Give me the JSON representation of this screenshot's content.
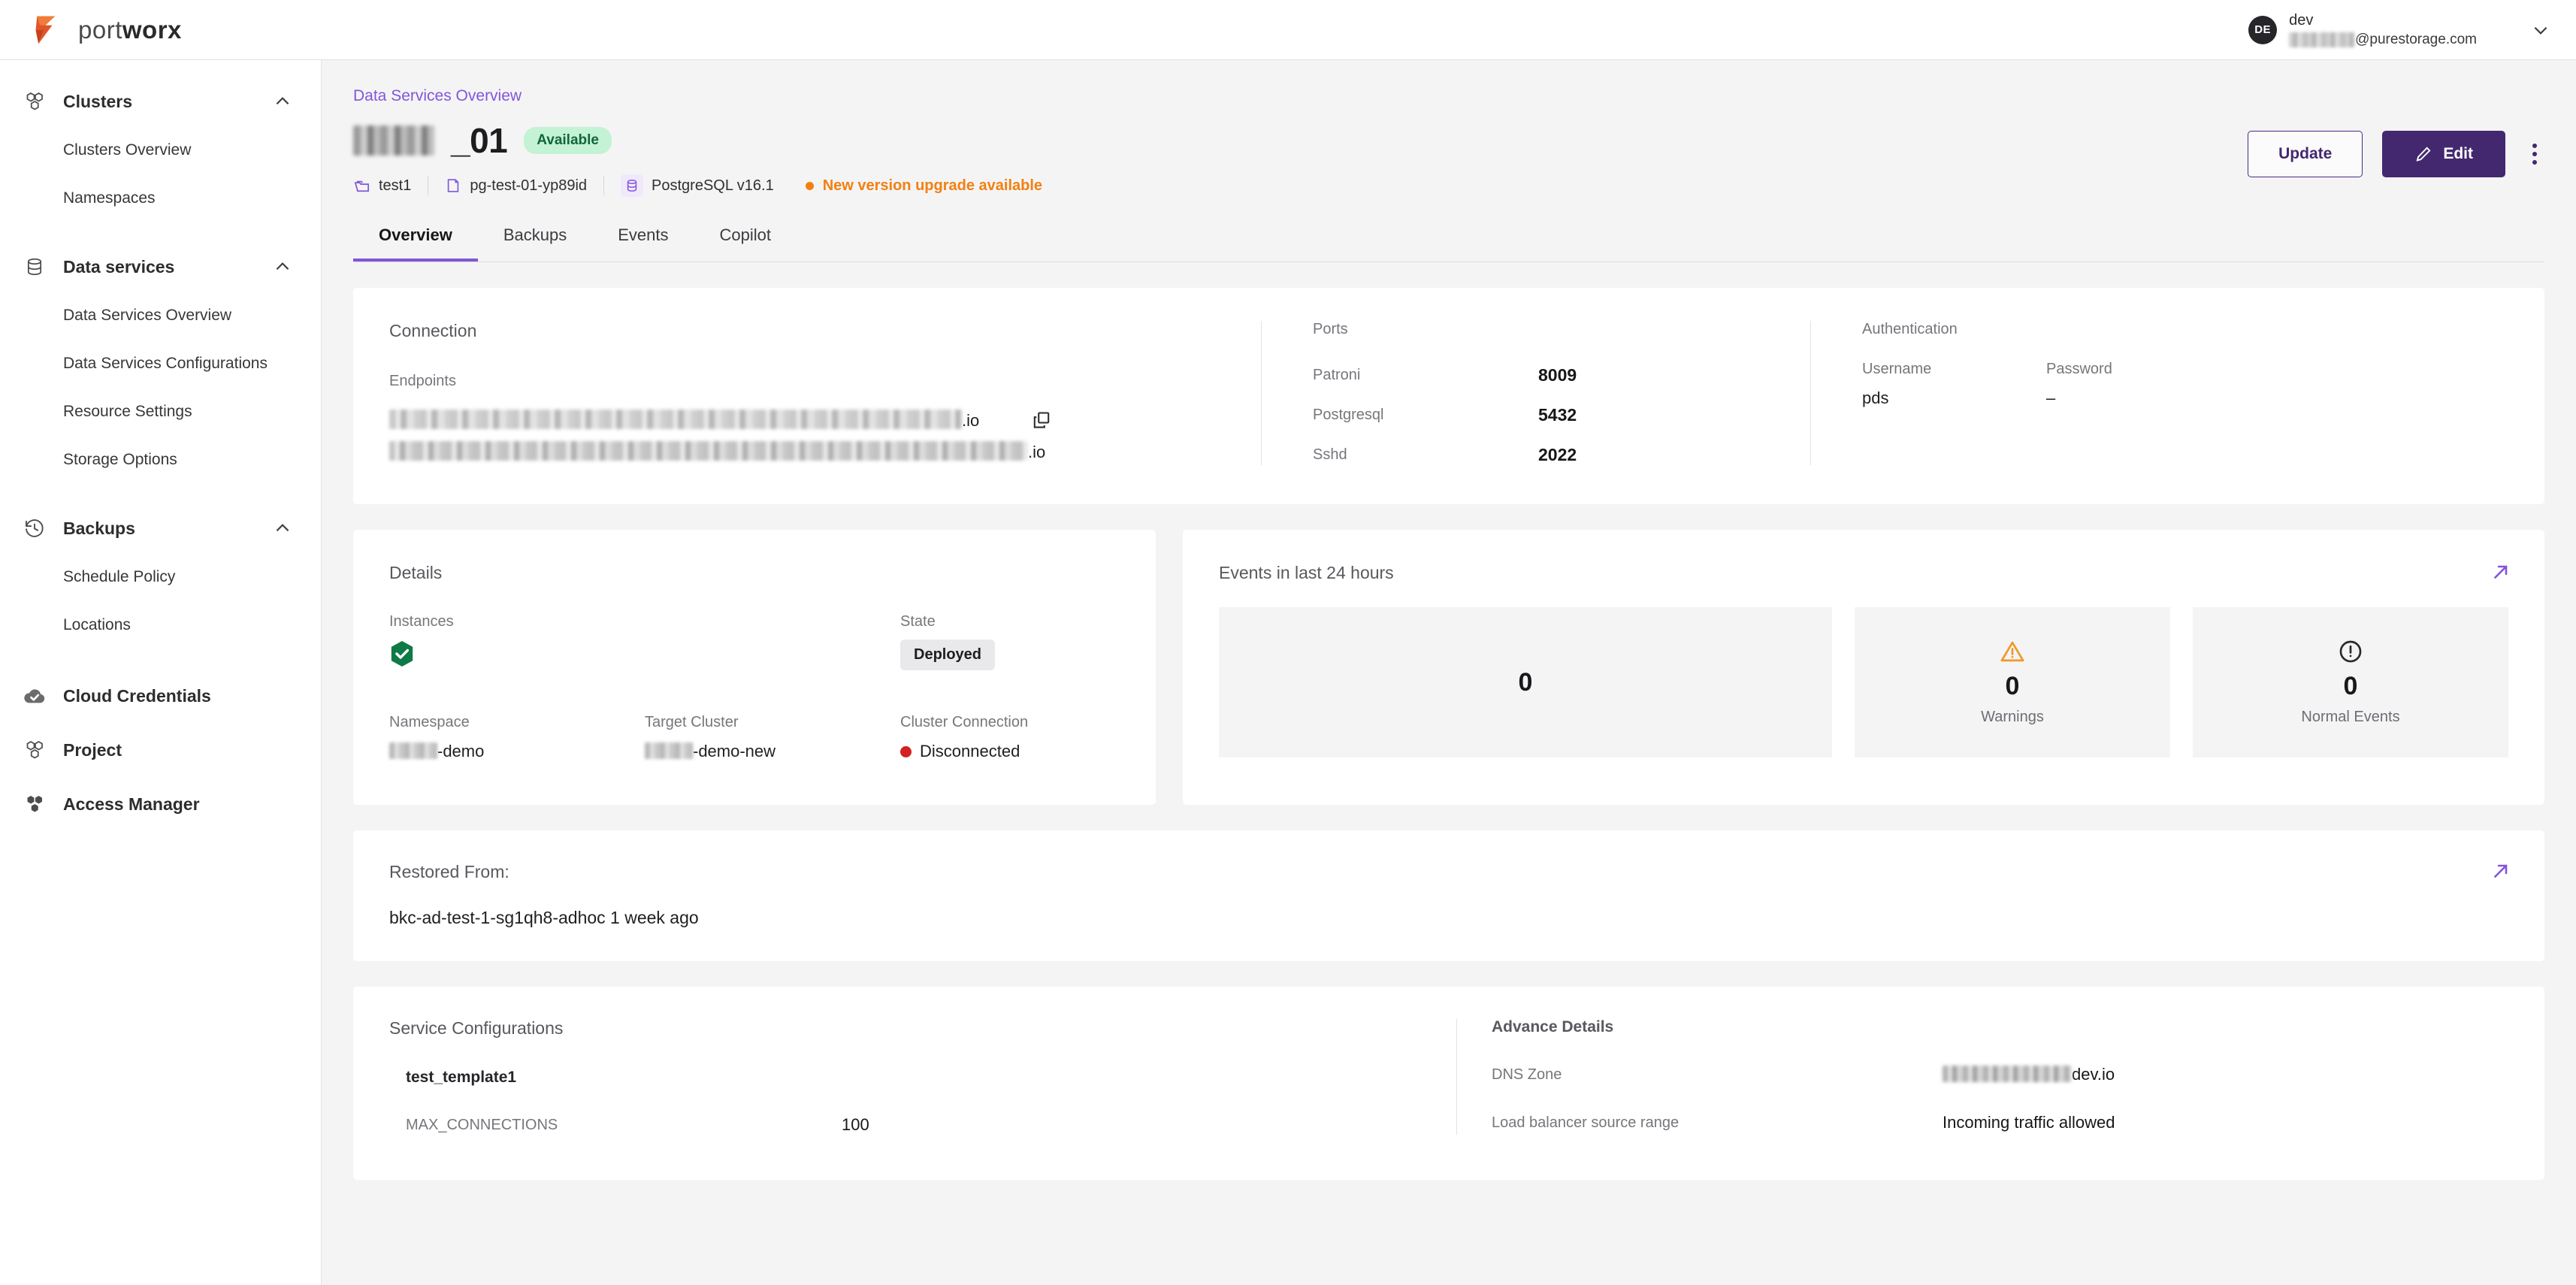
{
  "brand": {
    "name_light": "port",
    "name_bold": "worx"
  },
  "user": {
    "initials": "DE",
    "name": "dev",
    "email_domain": "@purestorage.com"
  },
  "sidebar": {
    "groups": [
      {
        "label": "Clusters",
        "icon": "cubes-icon",
        "expanded": true,
        "items": [
          {
            "label": "Clusters Overview"
          },
          {
            "label": "Namespaces"
          }
        ]
      },
      {
        "label": "Data services",
        "icon": "database-icon",
        "expanded": true,
        "items": [
          {
            "label": "Data Services Overview"
          },
          {
            "label": "Data Services Configurations"
          },
          {
            "label": "Resource Settings"
          },
          {
            "label": "Storage Options"
          }
        ]
      },
      {
        "label": "Backups",
        "icon": "history-icon",
        "expanded": true,
        "items": [
          {
            "label": "Schedule Policy"
          },
          {
            "label": "Locations"
          }
        ]
      }
    ],
    "solo_items": [
      {
        "label": "Cloud Credentials",
        "icon": "cloud-check-icon"
      },
      {
        "label": "Project",
        "icon": "cubes-outline-icon"
      },
      {
        "label": "Access Manager",
        "icon": "cubes-solid-icon"
      }
    ]
  },
  "header": {
    "breadcrumb": "Data Services Overview",
    "title_suffix": "_01",
    "status_badge": "Available",
    "meta": {
      "project": "test1",
      "deployment": "pg-test-01-yp89id",
      "engine": "PostgreSQL v16.1",
      "upgrade_notice": "New version upgrade available"
    },
    "actions": {
      "update_label": "Update",
      "edit_label": "Edit"
    }
  },
  "tabs": [
    {
      "label": "Overview",
      "active": true
    },
    {
      "label": "Backups",
      "active": false
    },
    {
      "label": "Events",
      "active": false
    },
    {
      "label": "Copilot",
      "active": false
    }
  ],
  "connection": {
    "title": "Connection",
    "endpoints_label": "Endpoints",
    "endpoint_suffix_1": ".io",
    "endpoint_suffix_2": ".io",
    "ports_label": "Ports",
    "ports": [
      {
        "name": "Patroni",
        "value": "8009"
      },
      {
        "name": "Postgresql",
        "value": "5432"
      },
      {
        "name": "Sshd",
        "value": "2022"
      }
    ],
    "auth_label": "Authentication",
    "auth": {
      "username_label": "Username",
      "username_value": "pds",
      "password_label": "Password",
      "password_value": "–"
    }
  },
  "details": {
    "title": "Details",
    "instances_label": "Instances",
    "state_label": "State",
    "state_value": "Deployed",
    "namespace_label": "Namespace",
    "namespace_value": "-demo",
    "target_cluster_label": "Target Cluster",
    "target_cluster_value": "-demo-new",
    "cluster_connection_label": "Cluster Connection",
    "cluster_connection_value": "Disconnected"
  },
  "events": {
    "title": "Events in last 24 hours",
    "boxes": [
      {
        "count": "0",
        "label": ""
      },
      {
        "count": "0",
        "label": "Warnings",
        "icon": "warning-triangle-icon"
      },
      {
        "count": "0",
        "label": "Normal Events",
        "icon": "info-circle-icon"
      }
    ]
  },
  "restored": {
    "title": "Restored From:",
    "value": "bkc-ad-test-1-sg1qh8-adhoc 1 week ago"
  },
  "service_config": {
    "title": "Service Configurations",
    "template_name": "test_template1",
    "rows": [
      {
        "key": "MAX_CONNECTIONS",
        "value": "100"
      }
    ],
    "advance_title": "Advance Details",
    "advance_rows": [
      {
        "key": "DNS Zone",
        "value": "dev.io",
        "redacted": true
      },
      {
        "key": "Load balancer source range",
        "value": "Incoming traffic allowed",
        "redacted": false
      }
    ]
  },
  "colors": {
    "accent_purple": "#7e57d6",
    "brand_dark_purple": "#43286f",
    "link_purple": "#8256d9",
    "warning_orange": "#f28011",
    "success_green": "#0f7a46",
    "error_red": "#d32020",
    "logo_orange": "#e0562a"
  }
}
